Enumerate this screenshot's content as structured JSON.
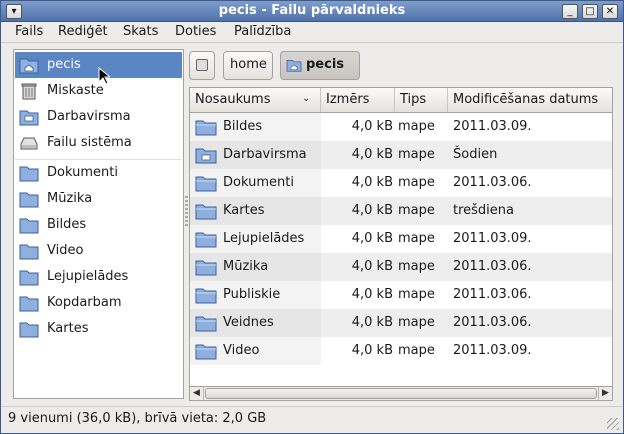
{
  "window": {
    "title": "pecis - Failu pārvaldnieks"
  },
  "menubar": {
    "items": [
      "Fails",
      "Rediģēt",
      "Skats",
      "Doties",
      "Palīdzība"
    ]
  },
  "sidebar": {
    "items": [
      {
        "label": "pecis",
        "icon": "home-folder-icon",
        "selected": true
      },
      {
        "label": "Miskaste",
        "icon": "trash-icon"
      },
      {
        "label": "Darbavirsma",
        "icon": "desktop-folder-icon"
      },
      {
        "label": "Failu sistēma",
        "icon": "drive-icon"
      },
      {
        "label": "Dokumenti",
        "icon": "folder-icon"
      },
      {
        "label": "Mūzika",
        "icon": "folder-icon"
      },
      {
        "label": "Bildes",
        "icon": "folder-icon"
      },
      {
        "label": "Video",
        "icon": "folder-icon"
      },
      {
        "label": "Lejupielādes",
        "icon": "folder-icon"
      },
      {
        "label": "Kopdarbam",
        "icon": "folder-icon"
      },
      {
        "label": "Kartes",
        "icon": "folder-icon"
      }
    ]
  },
  "pathbar": {
    "segments": [
      "home",
      "pecis"
    ]
  },
  "filelist": {
    "columns": [
      "Nosaukums",
      "Izmērs",
      "Tips",
      "Modificēšanas datums"
    ],
    "rows": [
      {
        "name": "Bildes",
        "size": "4,0 kB",
        "type": "mape",
        "date": "2011.03.09."
      },
      {
        "name": "Darbavirsma",
        "size": "4,0 kB",
        "type": "mape",
        "date": "Šodien"
      },
      {
        "name": "Dokumenti",
        "size": "4,0 kB",
        "type": "mape",
        "date": "2011.03.06."
      },
      {
        "name": "Kartes",
        "size": "4,0 kB",
        "type": "mape",
        "date": "trešdiena"
      },
      {
        "name": "Lejupielādes",
        "size": "4,0 kB",
        "type": "mape",
        "date": "2011.03.09."
      },
      {
        "name": "Mūzika",
        "size": "4,0 kB",
        "type": "mape",
        "date": "2011.03.06."
      },
      {
        "name": "Publiskie",
        "size": "4,0 kB",
        "type": "mape",
        "date": "2011.03.06."
      },
      {
        "name": "Veidnes",
        "size": "4,0 kB",
        "type": "mape",
        "date": "2011.03.06."
      },
      {
        "name": "Video",
        "size": "4,0 kB",
        "type": "mape",
        "date": "2011.03.09."
      }
    ]
  },
  "statusbar": {
    "text": "9 vienumi (36,0 kB), brīvā vieta: 2,0 GB"
  },
  "colors": {
    "titlebar": "#4f72aa",
    "selection": "#5b86c4",
    "folder": "#6f95cc"
  }
}
